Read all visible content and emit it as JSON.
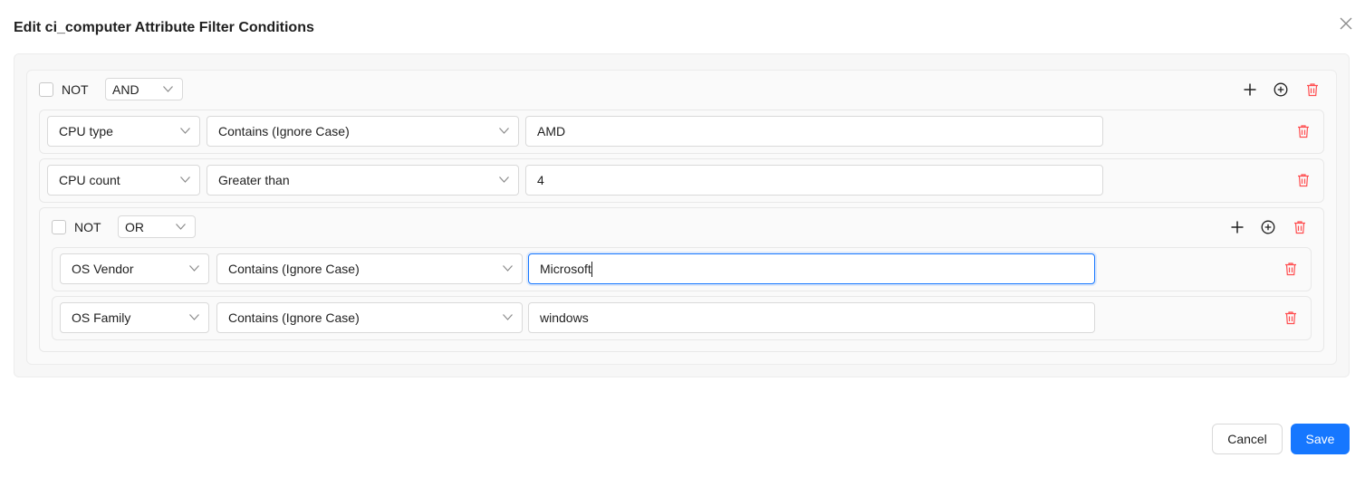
{
  "dialog": {
    "title": "Edit ci_computer Attribute Filter Conditions",
    "cancel_label": "Cancel",
    "save_label": "Save"
  },
  "colors": {
    "primary": "#1677ff",
    "danger": "#ff4d4f"
  },
  "group_outer": {
    "not_label": "NOT",
    "operator": "AND",
    "conditions": [
      {
        "field": "CPU type",
        "operator": "Contains (Ignore Case)",
        "value": "AMD"
      },
      {
        "field": "CPU count",
        "operator": "Greater than",
        "value": "4"
      }
    ]
  },
  "group_inner": {
    "not_label": "NOT",
    "operator": "OR",
    "conditions": [
      {
        "field": "OS Vendor",
        "operator": "Contains (Ignore Case)",
        "value": "Microsoft"
      },
      {
        "field": "OS Family",
        "operator": "Contains (Ignore Case)",
        "value": "windows"
      }
    ]
  },
  "icons": {
    "add": "plus-icon",
    "add_group": "plus-circle-icon",
    "delete": "trash-icon",
    "close": "close-icon",
    "dropdown": "chevron-down-icon"
  }
}
